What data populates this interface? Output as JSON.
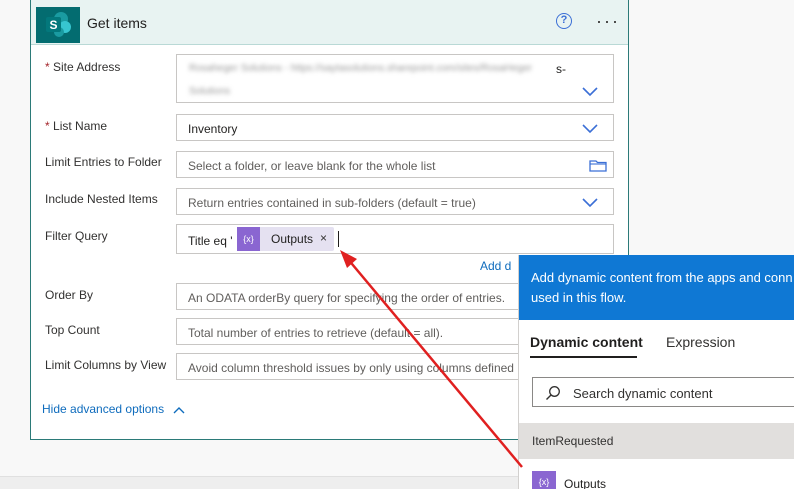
{
  "card": {
    "title": "Get items",
    "help_glyph": "?",
    "more_glyph": "···",
    "logo_letter": "S",
    "required_mark": "*",
    "site_address_label": "Site Address",
    "site_address_blurred_line1": "Rosaheger Solutions - https://saytasolutions.sharepoint.com/sites/RosaHeger",
    "site_address_line1_suffix": "s-",
    "site_address_blurred_line2": "Solutions",
    "list_name_label": "List Name",
    "list_name_value": "Inventory",
    "limit_folder_label": "Limit Entries to Folder",
    "limit_folder_placeholder": "Select a folder, or leave blank for the whole list",
    "nested_label": "Include Nested Items",
    "nested_placeholder": "Return entries contained in sub-folders (default = true)",
    "filter_label": "Filter Query",
    "filter_prefix": "Title eq '",
    "filter_token_label": "Outputs",
    "filter_token_icon": "{x}",
    "filter_token_remove": "×",
    "add_dynamic_label": "Add d",
    "order_by_label": "Order By",
    "order_by_placeholder": "An ODATA orderBy query for specifying the order of entries.",
    "top_count_label": "Top Count",
    "top_count_placeholder": "Total number of entries to retrieve (default = all).",
    "limit_view_label": "Limit Columns by View",
    "limit_view_placeholder": "Avoid column threshold issues by only using columns defined in a view",
    "hide_advanced_label": "Hide advanced options"
  },
  "panel": {
    "header_line1": "Add dynamic content from the apps and conn",
    "header_line2": "used in this flow.",
    "tab_dynamic": "Dynamic content",
    "tab_expression": "Expression",
    "search_placeholder": "Search dynamic content",
    "group_label": "ItemRequested",
    "item_label": "Outputs",
    "item_icon": "{x}"
  },
  "colors": {
    "accent_teal": "#036c70",
    "header_bg": "#e8f3f2",
    "link_blue": "#0f6cbd",
    "panel_blue": "#0f78d4",
    "token_purple": "#8a66d1",
    "arrow_red": "#e02020"
  }
}
